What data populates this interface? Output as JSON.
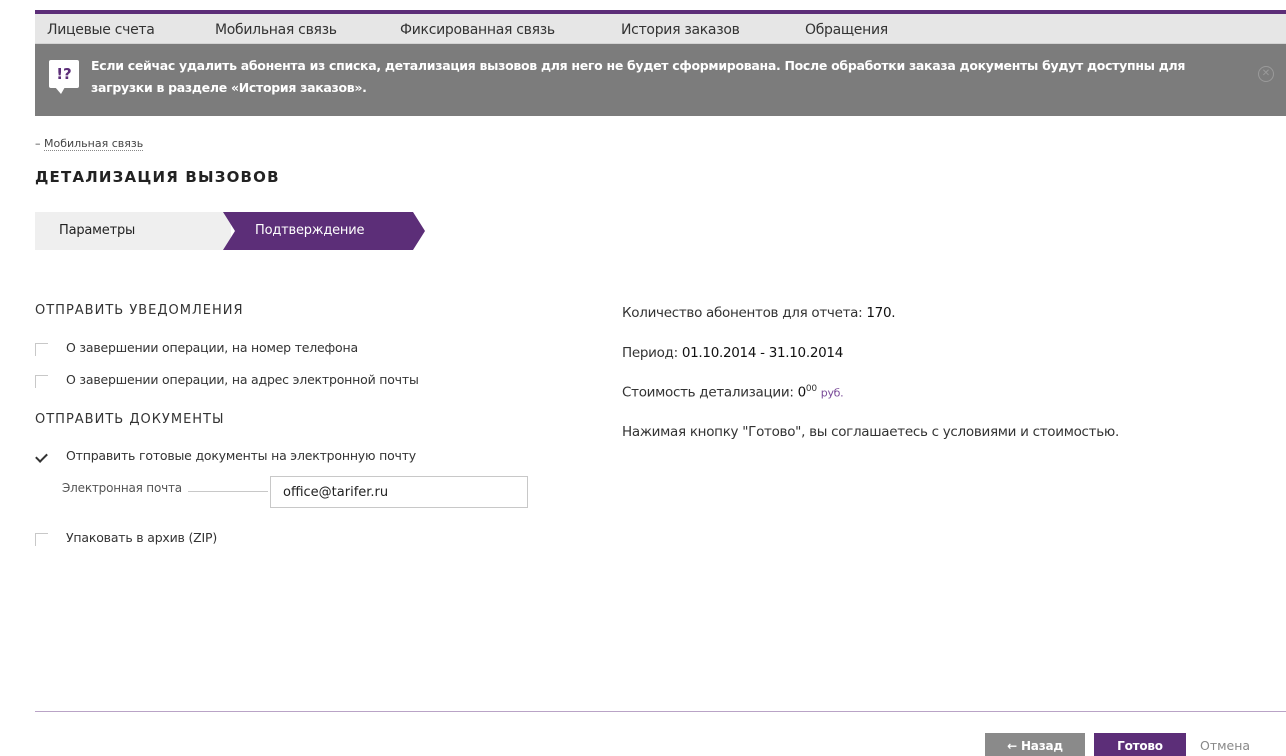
{
  "nav": {
    "items": [
      {
        "label": "Лицевые счета"
      },
      {
        "label": "Мобильная связь"
      },
      {
        "label": "Фиксированная связь"
      },
      {
        "label": "История заказов"
      },
      {
        "label": "Обращения"
      }
    ]
  },
  "alert": {
    "icon": "question-exclamation-icon",
    "text": "Если сейчас удалить абонента из списка, детализация вызовов для него не будет сформирована. После обработки заказа документы будут доступны для загрузки в разделе «История заказов».",
    "close_icon": "close-icon"
  },
  "breadcrumb": {
    "prefix": "–",
    "label": "Мобильная связь"
  },
  "page": {
    "title": "ДЕТАЛИЗАЦИЯ ВЫЗОВОВ"
  },
  "steps": [
    {
      "label": "Параметры",
      "active": false
    },
    {
      "label": "Подтверждение",
      "active": true
    }
  ],
  "notifications": {
    "title": "ОТПРАВИТЬ УВЕДОМЛЕНИЯ",
    "options": [
      {
        "label": "О завершении операции, на номер телефона",
        "checked": false
      },
      {
        "label": "О завершении операции, на адрес электронной почты",
        "checked": false
      }
    ]
  },
  "documents": {
    "title": "ОТПРАВИТЬ ДОКУМЕНТЫ",
    "send_email": {
      "label": "Отправить готовые документы на электронную почту",
      "checked": true
    },
    "email_label": "Электронная почта",
    "email_value": "office@tarifer.ru",
    "zip": {
      "label": "Упаковать в архив (ZIP)",
      "checked": false
    }
  },
  "summary": {
    "count_label": "Количество абонентов для отчета:",
    "count_value": "170.",
    "period_label": "Период:",
    "period_value": "01.10.2014 - 31.10.2014",
    "cost_label": "Стоимость детализации:",
    "cost_value": "0",
    "cost_cents": "00",
    "cost_currency": "руб.",
    "agreement": "Нажимая кнопку \"Готово\", вы соглашаетесь с условиями и стоимостью."
  },
  "footer": {
    "back_label": "← Назад",
    "done_label": "Готово",
    "cancel_label": "Отмена"
  },
  "colors": {
    "accent": "#5c2e78",
    "alert_bg": "#7c7c7c",
    "nav_bg": "#e6e6e6"
  }
}
